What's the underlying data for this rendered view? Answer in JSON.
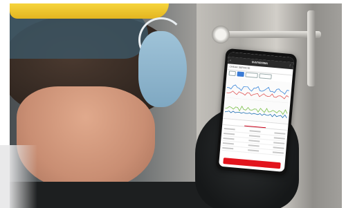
{
  "phone": {
    "app_title": "0V6700009A",
    "subheader": "CREAR SERVICIO",
    "tabs": [
      "",
      "",
      ""
    ],
    "active_tab": 1,
    "button_label": "",
    "chart_series_colors": [
      "#3a86d9",
      "#e05a5a",
      "#7cc14a",
      "#1f6fb2"
    ]
  }
}
